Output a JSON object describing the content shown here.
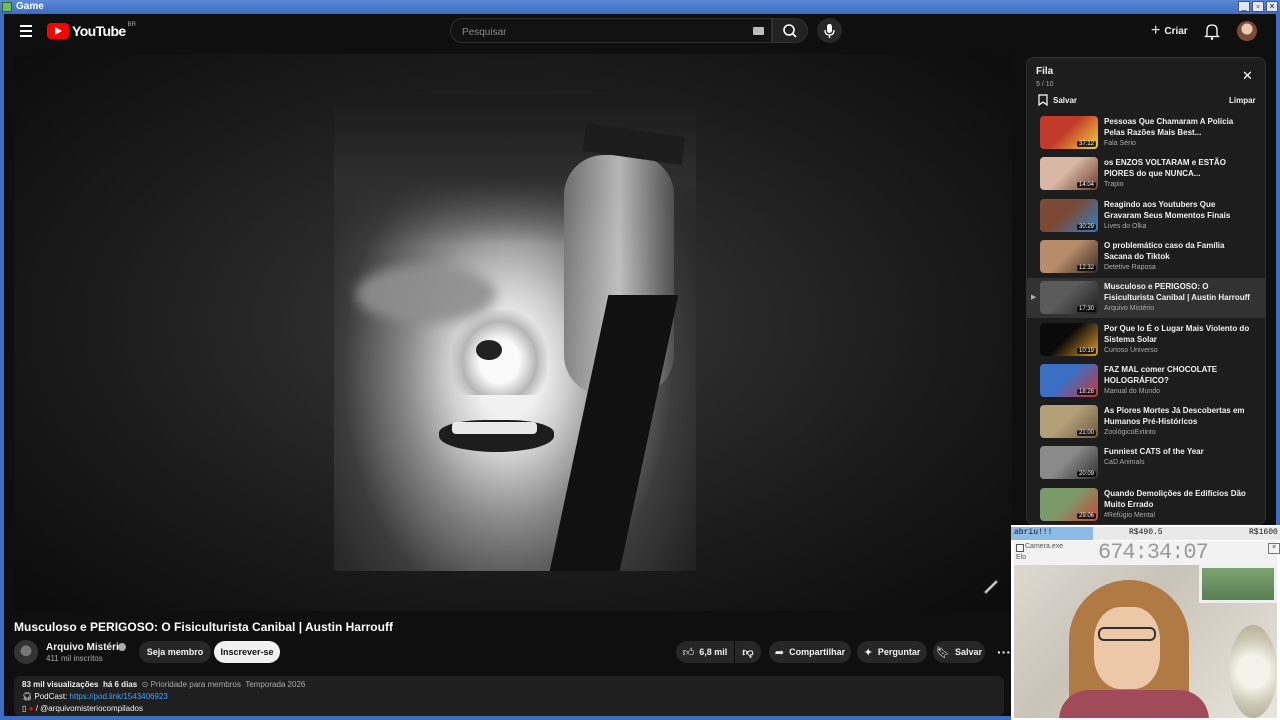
{
  "window": {
    "title": "Game"
  },
  "header": {
    "logo_text": "YouTube",
    "country_code": "BR",
    "search_placeholder": "Pesquisar",
    "create_label": "Criar"
  },
  "video": {
    "title": "Musculoso e PERIGOSO: O Fisiculturista Canibal | Austin Harrouff",
    "channel": "Arquivo Mistério",
    "subscribers": "411 mil inscritos",
    "member_label": "Seja membro",
    "subscribe_label": "Inscrever-se",
    "likes": "6,8 mil",
    "share_label": "Compartilhar",
    "ask_label": "Perguntar",
    "save_label": "Salvar",
    "more_label": "···",
    "description": {
      "views": "83 mil visualizações",
      "age": "há 6 dias",
      "tag1": "Prioridade para membros",
      "tag2": "Temporada 2026",
      "podcast_label": "PodCast:",
      "podcast_link": "https://pod.link/1543406923",
      "instagram": "/ @arquivomisteriocompilados"
    }
  },
  "queue": {
    "title": "Fila",
    "count": "5 / 10",
    "save_label": "Salvar",
    "clear_label": "Limpar",
    "items": [
      {
        "title": "Pessoas Que Chamaram A Polícia Pelas Razões Mais Best...",
        "channel": "Fala Sério",
        "duration": "37:12",
        "color1": "#c23b2a",
        "color2": "#f1d33a"
      },
      {
        "title": "os ENZOS VOLTARAM e ESTÃO PIORES do que NUNCA...",
        "channel": "Trapio",
        "duration": "14:04",
        "color1": "#d8b7a4",
        "color2": "#6b3b2e"
      },
      {
        "title": "Reagindo aos Youtubers Que Gravaram Seus Momentos Finais",
        "channel": "Lives do Olka",
        "duration": "30:29",
        "color1": "#7a4a36",
        "color2": "#2f80c4"
      },
      {
        "title": "O problemático caso da Família Sacana do Tiktok",
        "channel": "Detetive Raposa",
        "duration": "12:32",
        "color1": "#b88c6a",
        "color2": "#3a2a24"
      },
      {
        "title": "Musculoso e PERIGOSO: O Fisiculturista Canibal | Austin Harrouff",
        "channel": "Arquivo Mistério",
        "duration": "17:30",
        "color1": "#5a5a5a",
        "color2": "#1e1e1e"
      },
      {
        "title": "Por Que Io É o Lugar Mais Violento do Sistema Solar",
        "channel": "Curioso Universo",
        "duration": "10:19",
        "color1": "#0a0a0a",
        "color2": "#e39b2b"
      },
      {
        "title": "FAZ MAL comer CHOCOLATE HOLOGRÁFICO?",
        "channel": "Manual do Mundo",
        "duration": "18:28",
        "color1": "#3b6fc4",
        "color2": "#c9343a"
      },
      {
        "title": "As Piores Mortes Já Descobertas em Humanos Pré-Históricos",
        "channel": "ZoológicoExtinto",
        "duration": "21:00",
        "color1": "#b3a079",
        "color2": "#6c5a3e"
      },
      {
        "title": "Funniest CATS of the Year",
        "channel": "CaD Animals",
        "duration": "20:09",
        "color1": "#8a8a8a",
        "color2": "#2e2e2e"
      },
      {
        "title": "Quando Demolições de Edifícios Dão Muito Errado",
        "channel": "#Refúgio Mental",
        "duration": "29:06",
        "color1": "#7a9a6a",
        "color2": "#c64a3a"
      }
    ]
  },
  "overlay": {
    "label": "abriu!!!",
    "amount1": "R$490.5",
    "amount2": "R$1600",
    "app": "Camera.exe",
    "sub": "Elo",
    "timer": "674:34:07"
  },
  "colors": {
    "background": "#0f0f0f",
    "accent_red": "#ff0000",
    "link_blue": "#3ea6ff",
    "taskbar_blue": "#3d6cc0"
  }
}
